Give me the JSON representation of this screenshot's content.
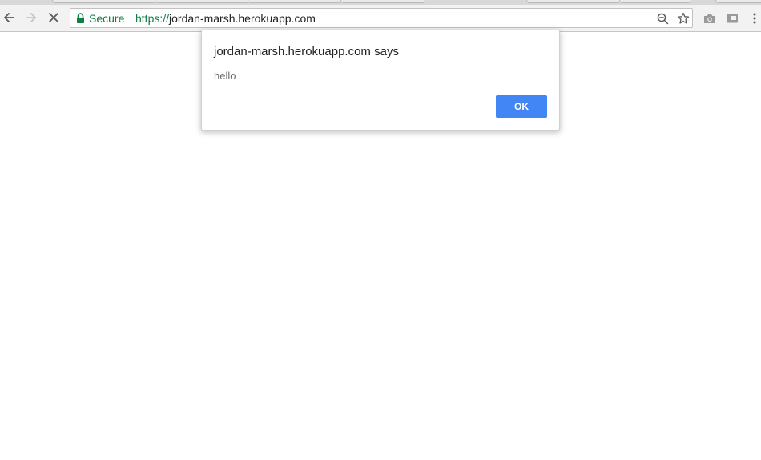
{
  "toolbar": {
    "back_icon": "arrow-left-icon",
    "forward_icon": "arrow-right-icon",
    "stop_icon": "close-icon",
    "omnibox": {
      "secure_label": "Secure",
      "url_scheme": "https://",
      "url_host": "jordan-marsh.herokuapp.com",
      "zoom_icon": "zoom-out-icon",
      "bookmark_icon": "star-icon"
    },
    "extensions": [
      "camera-icon",
      "cast-icon"
    ],
    "menu_icon": "kebab-menu-icon"
  },
  "dialog": {
    "title": "jordan-marsh.herokuapp.com says",
    "message": "hello",
    "ok_label": "OK"
  },
  "colors": {
    "secure": "#0b8043",
    "button_primary": "#4285f4"
  }
}
